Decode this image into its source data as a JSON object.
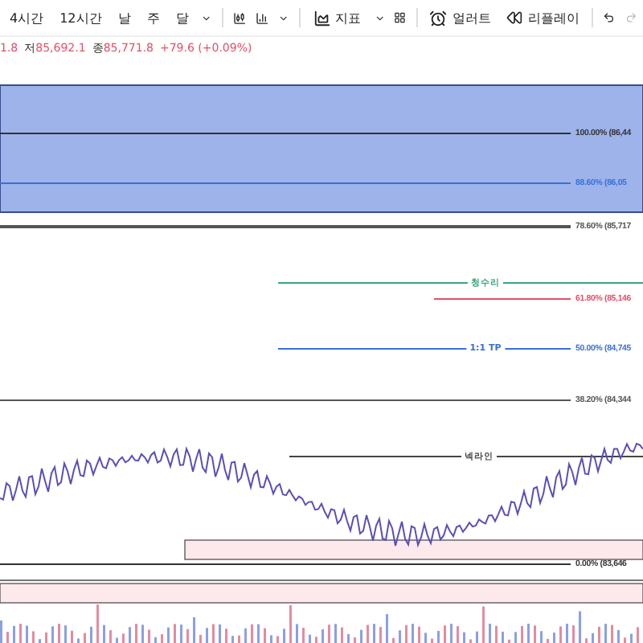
{
  "toolbar": {
    "intervals": [
      {
        "label": "4시간",
        "selected": false
      },
      {
        "label": "12시간",
        "selected": false
      },
      {
        "label": "날",
        "selected": false
      },
      {
        "label": "주",
        "selected": false
      },
      {
        "label": "달",
        "selected": false
      }
    ],
    "indicators": "지표",
    "alert": "얼러트",
    "replay": "리플레이"
  },
  "ohlc": [
    {
      "value": "1.8"
    },
    {
      "label": "저",
      "value": "85,692.1"
    },
    {
      "label": "종",
      "value": "85,771.8"
    },
    {
      "value": "+79.6 (+0.09%)"
    }
  ],
  "fib_levels": [
    {
      "label": "100.00% (86,44",
      "color": "#333333"
    },
    {
      "label": "88.60% (86,05",
      "color": "#3b6fd8"
    },
    {
      "label": "78.60% (85,717",
      "color": "#555555"
    },
    {
      "label": "61.80% (85,146",
      "color": "#e0506a"
    },
    {
      "label": "50.00% (84,745",
      "color": "#3b6fd8"
    },
    {
      "label": "38.20% (84,344",
      "color": "#555555"
    },
    {
      "label": "0.00% (83,646",
      "color": "#333333"
    }
  ],
  "line_tags": [
    {
      "label": "청수리",
      "color": "#3aa57a"
    },
    {
      "label": "1:1 TP",
      "color": "#3b6fd8"
    },
    {
      "label": "넥라인",
      "color": "#444444"
    }
  ]
}
